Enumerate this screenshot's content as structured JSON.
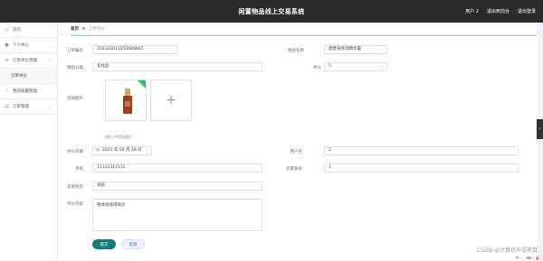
{
  "header": {
    "title": "闲置物品线上交易系统",
    "links": [
      "用户 2",
      "退出到前台",
      "退出登录"
    ]
  },
  "sidebar": {
    "items": [
      {
        "label": "首页",
        "icon": "home-icon"
      },
      {
        "label": "个人中心",
        "icon": "user-icon"
      },
      {
        "label": "订单评价管理",
        "icon": "list-icon"
      },
      {
        "label": "订单评价",
        "icon": ""
      },
      {
        "label": "我的收藏管理",
        "icon": "star-icon"
      },
      {
        "label": "订单管理",
        "icon": "order-icon"
      }
    ]
  },
  "breadcrumb": {
    "home": "首页",
    "current": "订单评价"
  },
  "form": {
    "order_no_label": "订单编号",
    "order_no_value": "202102011054608667",
    "product_name_label": "物品名称",
    "product_name_value": "碧欧泉保湿精华露",
    "category_label": "物品分类",
    "category_value": "化妆品",
    "rating_label": "评分",
    "rating_value": "5",
    "image_label": "添加图片",
    "image_hint": "请在上传添加图片",
    "date_label": "评价日期",
    "date_value": "2021 年 04 月 28 日",
    "account_label": "用户名",
    "account_value": "2",
    "phone_label": "手机",
    "phone_value": "12312312312",
    "seller_label": "卖家账号",
    "seller_value": "1",
    "reviewer_label": "卖家姓名",
    "reviewer_value": "张栋",
    "content_label": "评价内容",
    "content_value": "物体很值得购买"
  },
  "actions": {
    "submit": "提交",
    "cancel": "取消"
  },
  "footer": {
    "watermark": "CSDN @计算机毕设项目",
    "tray": "中 ·， ⌨ ♪ ◧"
  }
}
